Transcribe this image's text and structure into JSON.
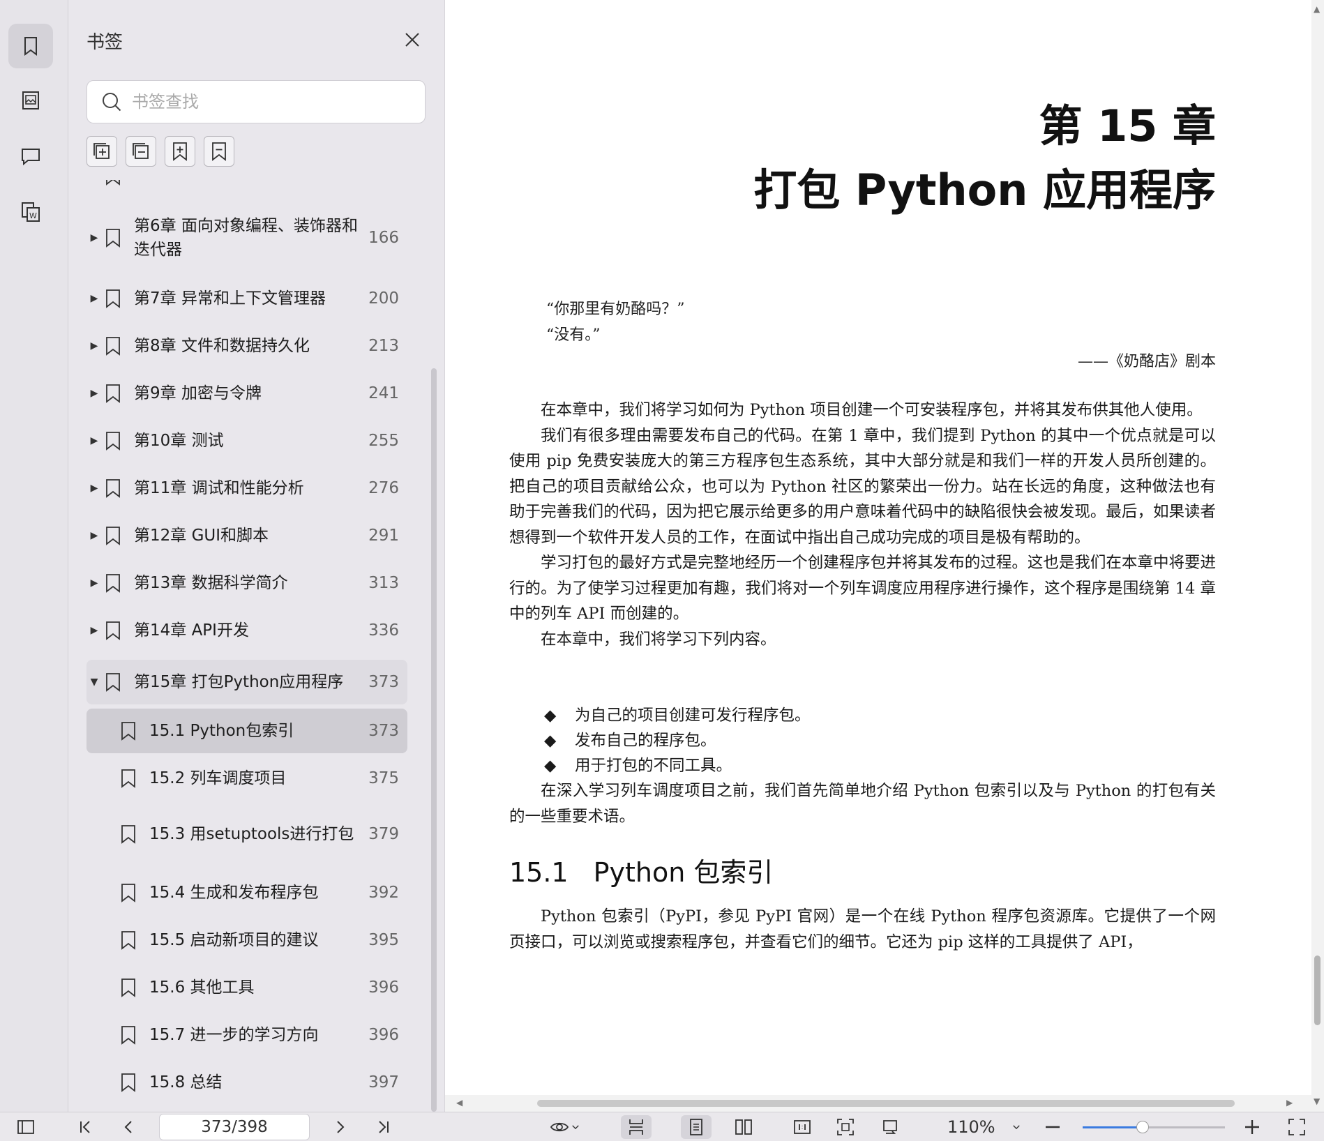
{
  "sidebar": {
    "title": "书签",
    "search_placeholder": "书签查找",
    "items": [
      {
        "label": "第6章 面向对象编程、装饰器和迭代器",
        "page": "166"
      },
      {
        "label": "第7章 异常和上下文管理器",
        "page": "200"
      },
      {
        "label": "第8章 文件和数据持久化",
        "page": "213"
      },
      {
        "label": "第9章 加密与令牌",
        "page": "241"
      },
      {
        "label": "第10章 测试",
        "page": "255"
      },
      {
        "label": "第11章 调试和性能分析",
        "page": "276"
      },
      {
        "label": "第12章 GUI和脚本",
        "page": "291"
      },
      {
        "label": "第13章 数据科学简介",
        "page": "313"
      },
      {
        "label": "第14章 API开发",
        "page": "336"
      },
      {
        "label": "第15章 打包Python应用程序",
        "page": "373"
      }
    ],
    "children": [
      {
        "label": "15.1 Python包索引",
        "page": "373"
      },
      {
        "label": "15.2 列车调度项目",
        "page": "375"
      },
      {
        "label": "15.3 用setuptools进行打包",
        "page": "379"
      },
      {
        "label": "15.4 生成和发布程序包",
        "page": "392"
      },
      {
        "label": "15.5 启动新项目的建议",
        "page": "395"
      },
      {
        "label": "15.6 其他工具",
        "page": "396"
      },
      {
        "label": "15.7 进一步的学习方向",
        "page": "396"
      },
      {
        "label": "15.8 总结",
        "page": "397"
      }
    ]
  },
  "document": {
    "chapter_number": "第 15 章",
    "chapter_title": "打包 Python 应用程序",
    "epigraph_line1": "“你那里有奶酪吗？”",
    "epigraph_line2": "“没有。”",
    "attribution": "——《奶酪店》剧本",
    "paragraphs": [
      "在本章中，我们将学习如何为 Python 项目创建一个可安装程序包，并将其发布供其他人使用。",
      "我们有很多理由需要发布自己的代码。在第 1 章中，我们提到 Python 的其中一个优点就是可以使用 pip 免费安装庞大的第三方程序包生态系统，其中大部分就是和我们一样的开发人员所创建的。把自己的项目贡献给公众，也可以为 Python 社区的繁荣出一份力。站在长远的角度，这种做法也有助于完善我们的代码，因为把它展示给更多的用户意味着代码中的缺陷很快会被发现。最后，如果读者想得到一个软件开发人员的工作，在面试中指出自己成功完成的项目是极有帮助的。",
      "学习打包的最好方式是完整地经历一个创建程序包并将其发布的过程。这也是我们在本章中将要进行的。为了使学习过程更加有趣，我们将对一个列车调度应用程序进行操作，这个程序是围绕第 14 章中的列车 API 而创建的。",
      "在本章中，我们将学习下列内容。"
    ],
    "bullets": [
      "为自己的项目创建可发行程序包。",
      "发布自己的程序包。",
      "用于打包的不同工具。"
    ],
    "closing_paragraph": "在深入学习列车调度项目之前，我们首先简单地介绍 Python 包索引以及与 Python 的打包有关的一些重要术语。",
    "section_number": "15.1",
    "section_title": "Python 包索引",
    "section_paragraph": "Python 包索引（PyPI，参见 PyPI 官网）是一个在线 Python 程序包资源库。它提供了一个网页接口，可以浏览或搜索程序包，并查看它们的细节。它还为 pip 这样的工具提供了 API，"
  },
  "toolbar": {
    "page_indicator": "373/398",
    "zoom": "110%",
    "zoom_fraction": 0.42
  },
  "colors": {
    "accent": "#3b7be0",
    "selected": "#cfcdd3"
  }
}
